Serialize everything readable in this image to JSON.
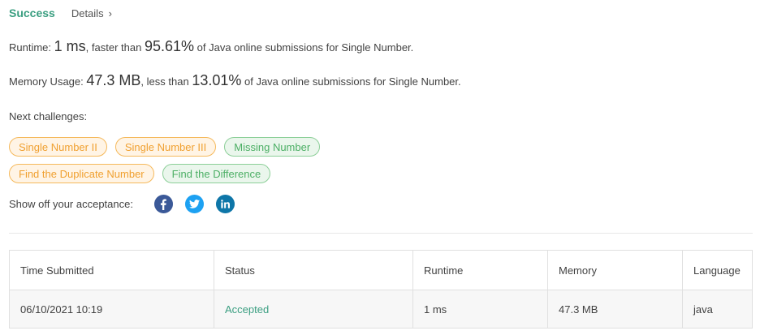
{
  "header": {
    "status": "Success",
    "details_label": "Details",
    "details_chevron": "›"
  },
  "runtime": {
    "label": "Runtime:",
    "value": "1 ms",
    "mid": ", faster than",
    "percent": "95.61%",
    "suffix": "of Java online submissions for Single Number."
  },
  "memory": {
    "label": "Memory Usage:",
    "value": "47.3 MB",
    "mid": ", less than",
    "percent": "13.01%",
    "suffix": "of Java online submissions for Single Number."
  },
  "next": {
    "label": "Next challenges:",
    "row1": [
      {
        "label": "Single Number II",
        "difficulty": "medium"
      },
      {
        "label": "Single Number III",
        "difficulty": "medium"
      },
      {
        "label": "Missing Number",
        "difficulty": "easy"
      }
    ],
    "row2": [
      {
        "label": "Find the Duplicate Number",
        "difficulty": "medium"
      },
      {
        "label": "Find the Difference",
        "difficulty": "easy"
      }
    ]
  },
  "share": {
    "label": "Show off your acceptance:",
    "icons": [
      "facebook-icon",
      "twitter-icon",
      "linkedin-icon"
    ]
  },
  "colors": {
    "accent": "#3a9e80",
    "medium": "#f0a030",
    "easy": "#4caf65"
  },
  "table": {
    "headers": [
      "Time Submitted",
      "Status",
      "Runtime",
      "Memory",
      "Language"
    ],
    "rows": [
      [
        "06/10/2021 10:19",
        "Accepted",
        "1 ms",
        "47.3 MB",
        "java"
      ]
    ]
  }
}
